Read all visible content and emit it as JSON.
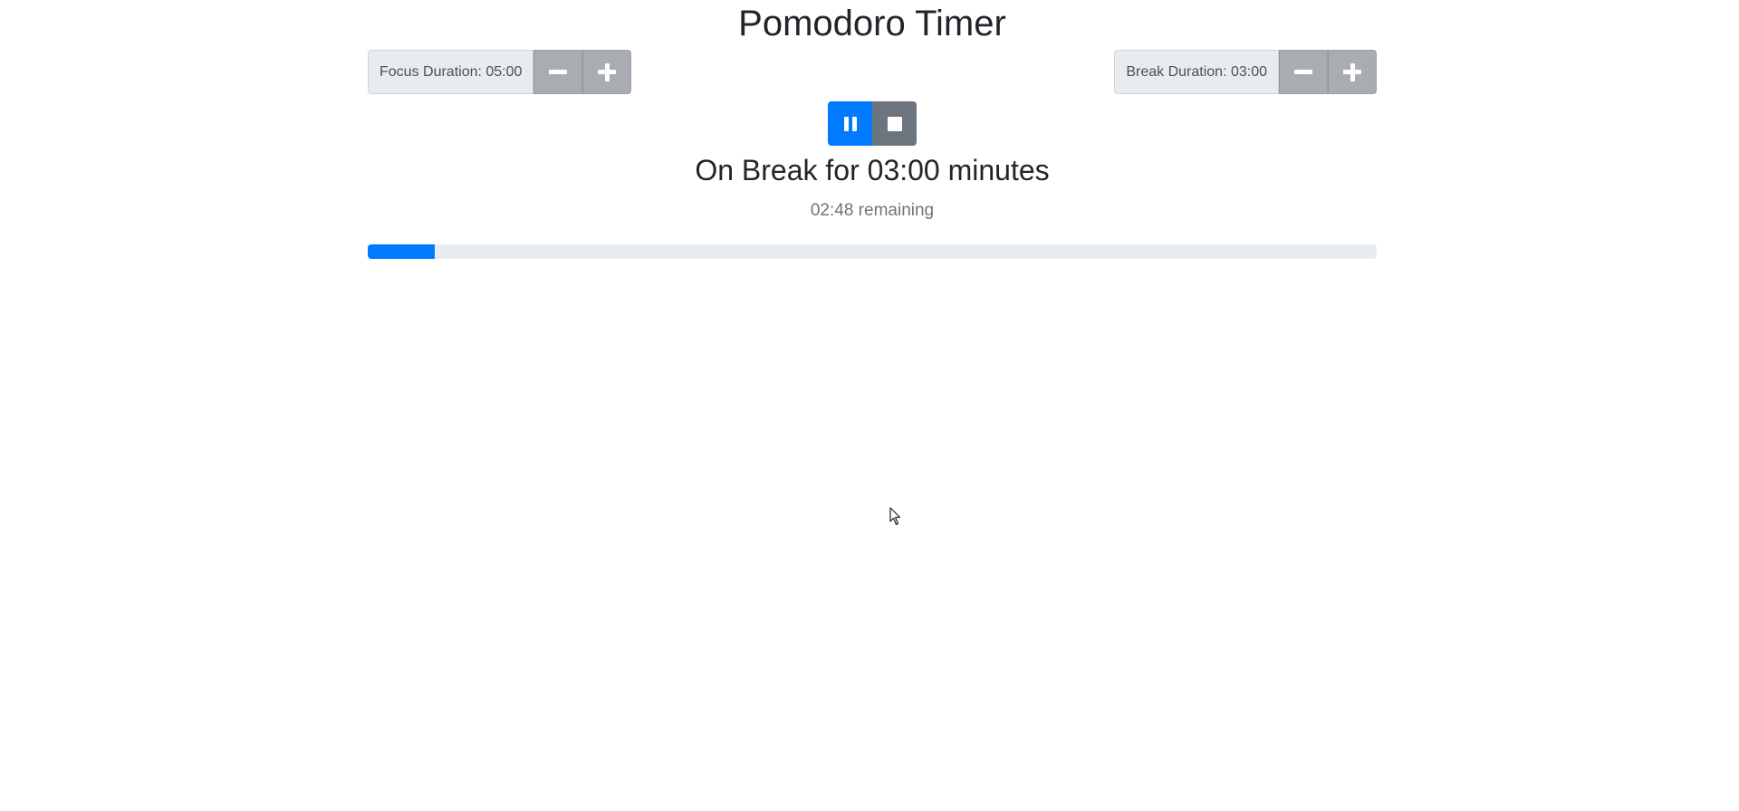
{
  "app": {
    "title": "Pomodoro Timer"
  },
  "focus": {
    "label": "Focus Duration: 05:00",
    "decrement_icon": "minus-icon",
    "increment_icon": "plus-icon"
  },
  "break": {
    "label": "Break Duration: 03:00",
    "decrement_icon": "minus-icon",
    "increment_icon": "plus-icon"
  },
  "controls": {
    "pause_icon": "pause-icon",
    "stop_icon": "stop-icon"
  },
  "status": {
    "text": "On Break for 03:00 minutes",
    "remaining": "02:48 remaining"
  },
  "progress": {
    "fraction": 0.0667,
    "fill_color": "#007bff",
    "track_color": "#e9ecef"
  },
  "colors": {
    "primary": "#007bff",
    "secondary": "#6c757d",
    "stepper": "#a9adb2"
  }
}
